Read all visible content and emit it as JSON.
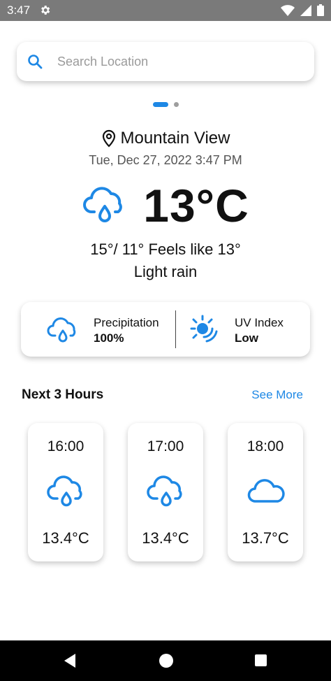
{
  "status_bar": {
    "time": "3:47"
  },
  "search": {
    "placeholder": "Search Location",
    "value": ""
  },
  "location": {
    "name": "Mountain View",
    "datetime": "Tue, Dec 27, 2022 3:47 PM"
  },
  "current": {
    "temperature": "13°C",
    "range_feels": "15°/ 11° Feels like 13°",
    "condition": "Light rain"
  },
  "details": {
    "precipitation_label": "Precipitation",
    "precipitation_value": "100%",
    "uv_label": "UV Index",
    "uv_value": "Low"
  },
  "forecast": {
    "title": "Next 3 Hours",
    "see_more": "See More",
    "hours": [
      {
        "time": "16:00",
        "icon": "rain-cloud-icon",
        "temp": "13.4°C"
      },
      {
        "time": "17:00",
        "icon": "rain-cloud-icon",
        "temp": "13.4°C"
      },
      {
        "time": "18:00",
        "icon": "cloud-icon",
        "temp": "13.7°C"
      }
    ]
  },
  "colors": {
    "accent": "#1e88e5",
    "status_bar": "#7a7a7a",
    "nav_bar": "#000000"
  }
}
